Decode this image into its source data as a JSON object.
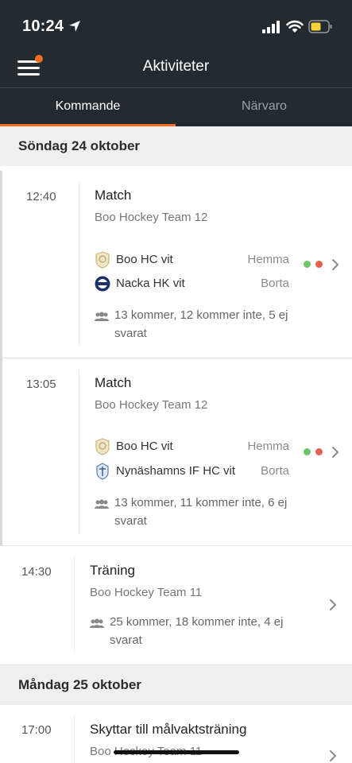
{
  "status_bar": {
    "time": "10:24"
  },
  "nav": {
    "title": "Aktiviteter",
    "menu_icon": "hamburger-icon"
  },
  "tabs": [
    {
      "label": "Kommande",
      "active": true
    },
    {
      "label": "Närvaro",
      "active": false
    }
  ],
  "colors": {
    "accent": "#f36f21",
    "header_bg": "#232a30",
    "dot_green": "#6cc56a",
    "dot_red": "#e3614f"
  },
  "days": [
    {
      "label": "Söndag 24 oktober",
      "events": [
        {
          "time": "12:40",
          "title": "Match",
          "team": "Boo Hockey Team 12",
          "home": {
            "name": "Boo HC vit",
            "place": "Hemma"
          },
          "away": {
            "name": "Nacka HK vit",
            "place": "Borta"
          },
          "attendance": "13 kommer, 12 kommer inte, 5 ej svarat"
        },
        {
          "time": "13:05",
          "title": "Match",
          "team": "Boo Hockey Team 12",
          "home": {
            "name": "Boo HC vit",
            "place": "Hemma"
          },
          "away": {
            "name": "Nynäshamns IF HC vit",
            "place": "Borta"
          },
          "attendance": "13 kommer, 11 kommer inte, 6 ej svarat"
        },
        {
          "time": "14:30",
          "title": "Träning",
          "team": "Boo Hockey Team 11",
          "attendance": "25 kommer, 18 kommer inte, 4 ej svarat"
        }
      ]
    },
    {
      "label": "Måndag 25 oktober",
      "events": [
        {
          "time": "17:00",
          "title": "Skyttar till målvaktsträning",
          "team": "Boo Hockey Team 11"
        }
      ]
    }
  ]
}
